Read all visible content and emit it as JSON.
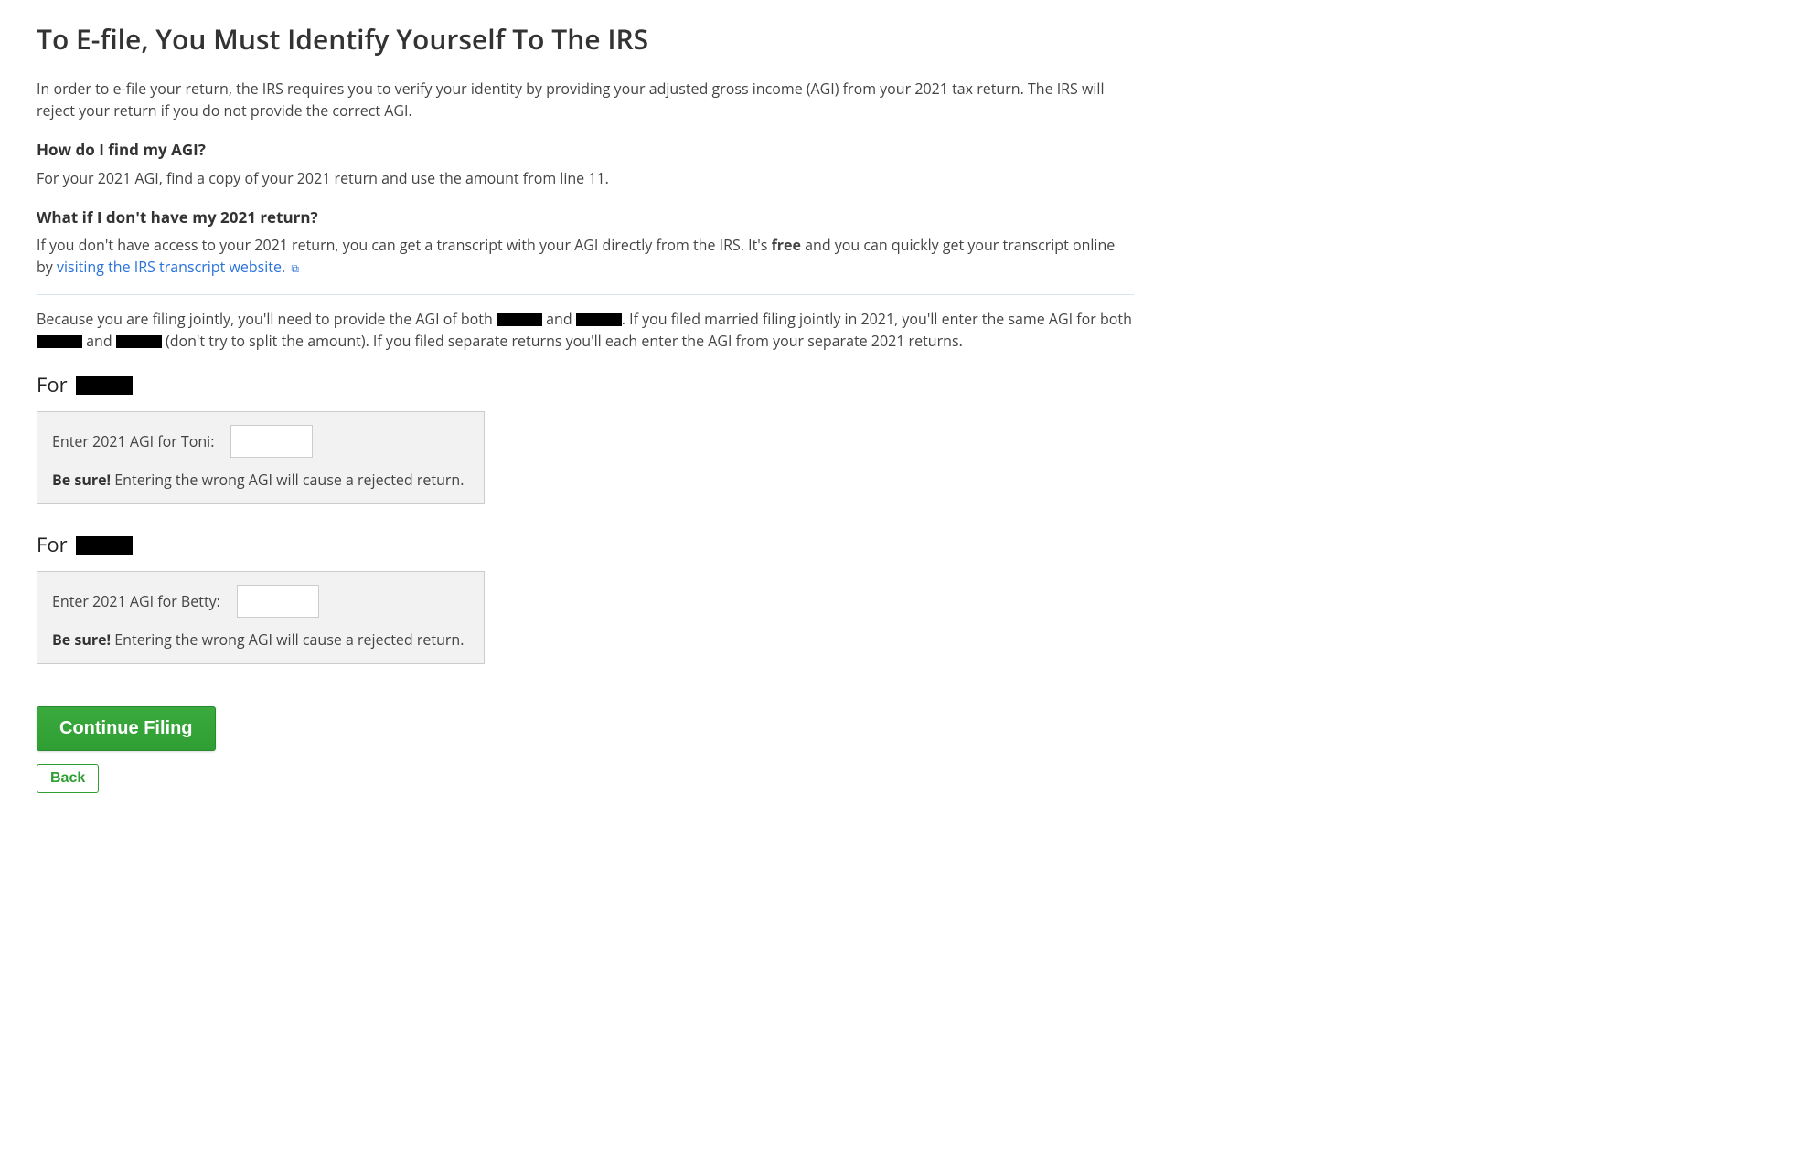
{
  "page": {
    "title": "To E-file, You Must Identify Yourself To The IRS",
    "intro": "In order to e-file your return, the IRS requires you to verify your identity by providing your adjusted gross income (AGI) from your 2021 tax return. The IRS will reject your return if you do not provide the correct AGI.",
    "findAgi": {
      "heading": "How do I find my AGI?",
      "text": "For your 2021 AGI, find a copy of your 2021 return and use the amount from line 11."
    },
    "noReturn": {
      "heading": "What if I don't have my 2021 return?",
      "pre": "If you don't have access to your 2021 return, you can get a transcript with your AGI directly from the IRS. It's ",
      "free": "free",
      "mid": " and you can quickly get your transcript online by ",
      "link": "visiting the IRS transcript website."
    },
    "joint": {
      "pre": "Because you are filing jointly, you'll need to provide the AGI of both ",
      "and": " and ",
      "mid": ". If you filed married filing jointly in 2021, you'll enter the same AGI for both ",
      "and2": " and ",
      "post": " (don't try to split the amount). If you filed separate returns you'll each enter the AGI from your separate 2021 returns."
    },
    "sections": [
      {
        "forPrefix": "For ",
        "inputLabel": "Enter 2021 AGI for Toni:",
        "warningBold": "Be sure!",
        "warningText": " Entering the wrong AGI will cause a rejected return."
      },
      {
        "forPrefix": "For ",
        "inputLabel": "Enter 2021 AGI for Betty:",
        "warningBold": "Be sure!",
        "warningText": " Entering the wrong AGI will cause a rejected return."
      }
    ],
    "buttons": {
      "continue": "Continue Filing",
      "back": "Back"
    }
  }
}
